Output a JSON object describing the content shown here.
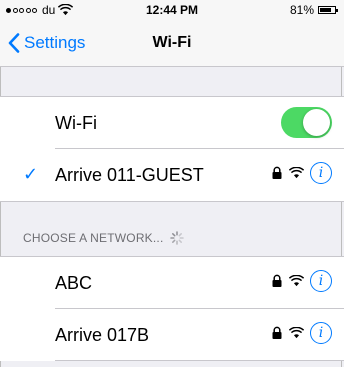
{
  "status_bar": {
    "carrier": "du",
    "time": "12:44 PM",
    "battery_text": "81%",
    "battery_level": 0.81,
    "signal_bars_filled": 1,
    "signal_bars_total": 5
  },
  "nav": {
    "back_label": "Settings",
    "title": "Wi-Fi"
  },
  "wifi_row": {
    "label": "Wi-Fi",
    "enabled": true
  },
  "connected_network": {
    "name": "Arrive 011-GUEST",
    "secured": true,
    "connected": true
  },
  "networks_section": {
    "header": "CHOOSE A NETWORK...",
    "networks": [
      {
        "name": "ABC",
        "secured": true
      },
      {
        "name": "Arrive 017B",
        "secured": true
      }
    ]
  },
  "colors": {
    "accent": "#007aff",
    "toggle_on": "#4cd964",
    "background": "#efeff4"
  }
}
